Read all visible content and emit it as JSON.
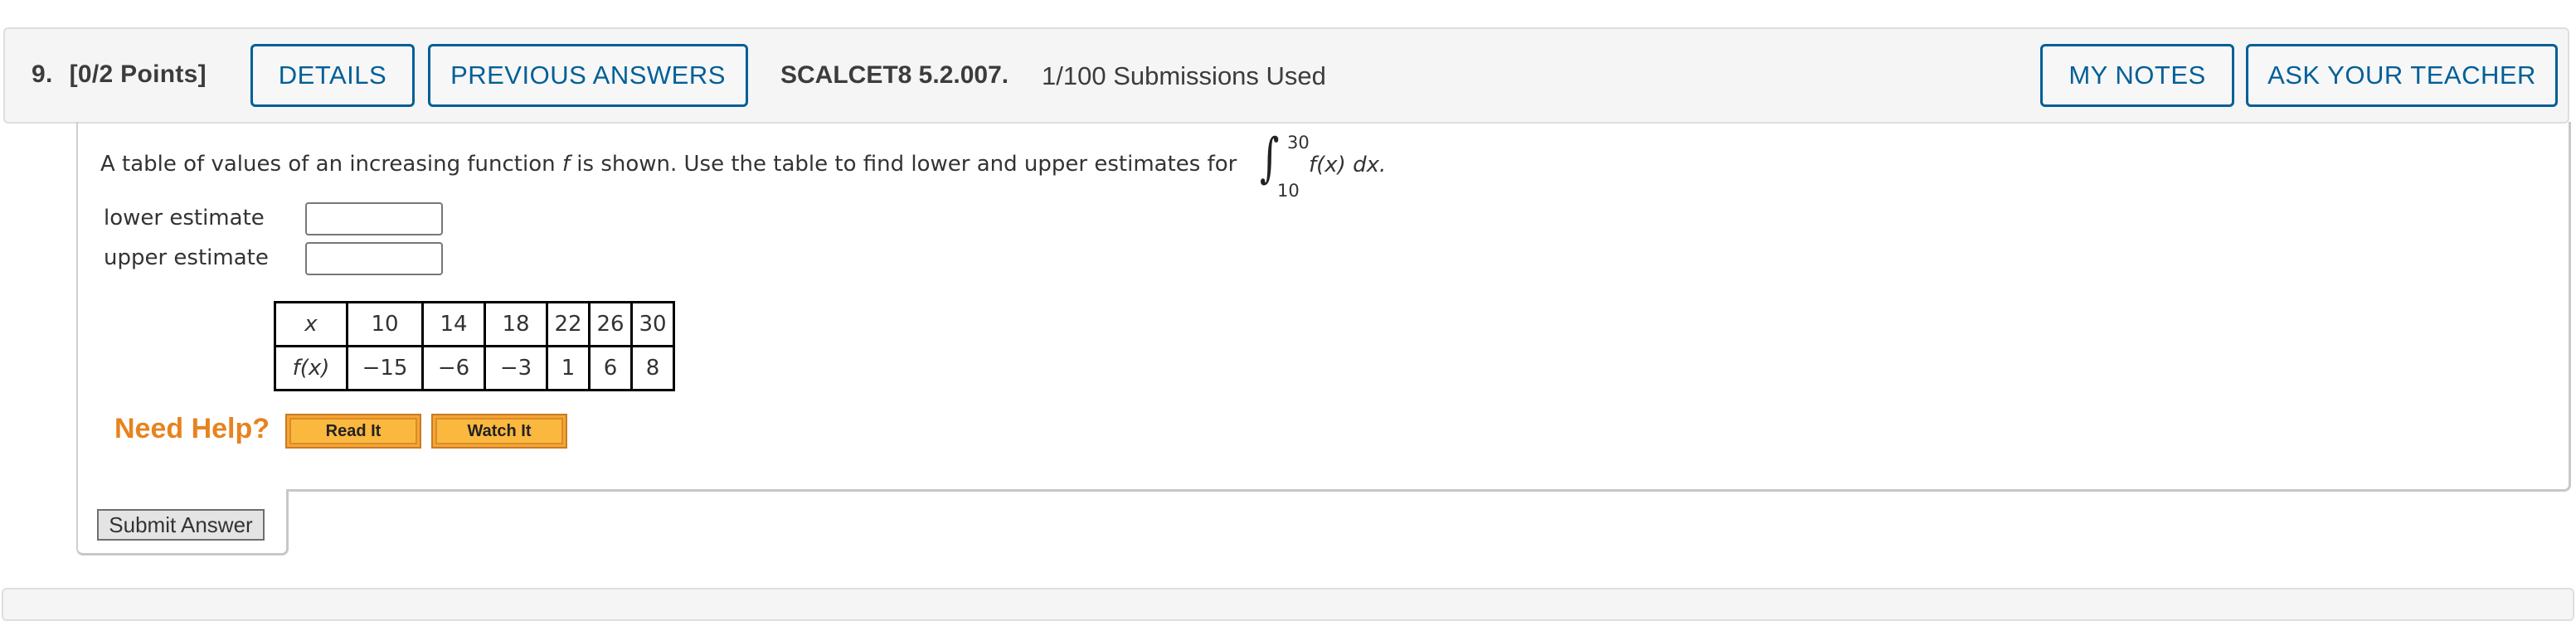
{
  "header": {
    "question_number": "9.",
    "points": "[0/2 Points]",
    "details_label": "DETAILS",
    "previous_answers_label": "PREVIOUS ANSWERS",
    "problem_code": "SCALCET8 5.2.007.",
    "submissions": "1/100 Submissions Used",
    "my_notes_label": "MY NOTES",
    "ask_teacher_label": "ASK YOUR TEACHER"
  },
  "question": {
    "prompt_part1": "A table of values of an increasing function ",
    "prompt_var": "f",
    "prompt_part2": " is shown. Use the table to find lower and upper estimates for",
    "integral": {
      "lower_limit": "10",
      "upper_limit": "30",
      "integrand": "f(x) dx."
    },
    "lower_label": "lower estimate",
    "lower_value": "",
    "upper_label": "upper estimate",
    "upper_value": ""
  },
  "table": {
    "row_headers": [
      "x",
      "f(x)"
    ],
    "x": [
      "10",
      "14",
      "18",
      "22",
      "26",
      "30"
    ],
    "fx": [
      "−15",
      "−6",
      "−3",
      "1",
      "6",
      "8"
    ]
  },
  "help": {
    "label": "Need Help?",
    "read_it": "Read It",
    "watch_it": "Watch It"
  },
  "submit_label": "Submit Answer",
  "colors": {
    "accent": "#005f97",
    "help_orange": "#e8821f",
    "help_button": "#fbb83f"
  }
}
